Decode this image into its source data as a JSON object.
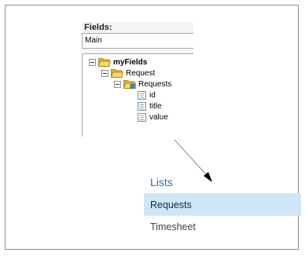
{
  "fields_panel": {
    "label": "Fields:",
    "view_selected": "Main",
    "tree": {
      "root": "myFields",
      "group": "Request",
      "repeating_group": "Requests",
      "fields": [
        "id",
        "title",
        "value"
      ]
    }
  },
  "lists_nav": {
    "header": "Lists",
    "items": [
      "Requests",
      "Timesheet"
    ],
    "selected_item": "Requests"
  },
  "colors": {
    "lists_header_text": "#2a6db3",
    "selected_row_bg": "#cfe6f7",
    "folder_yellow": "#f2c84b"
  }
}
